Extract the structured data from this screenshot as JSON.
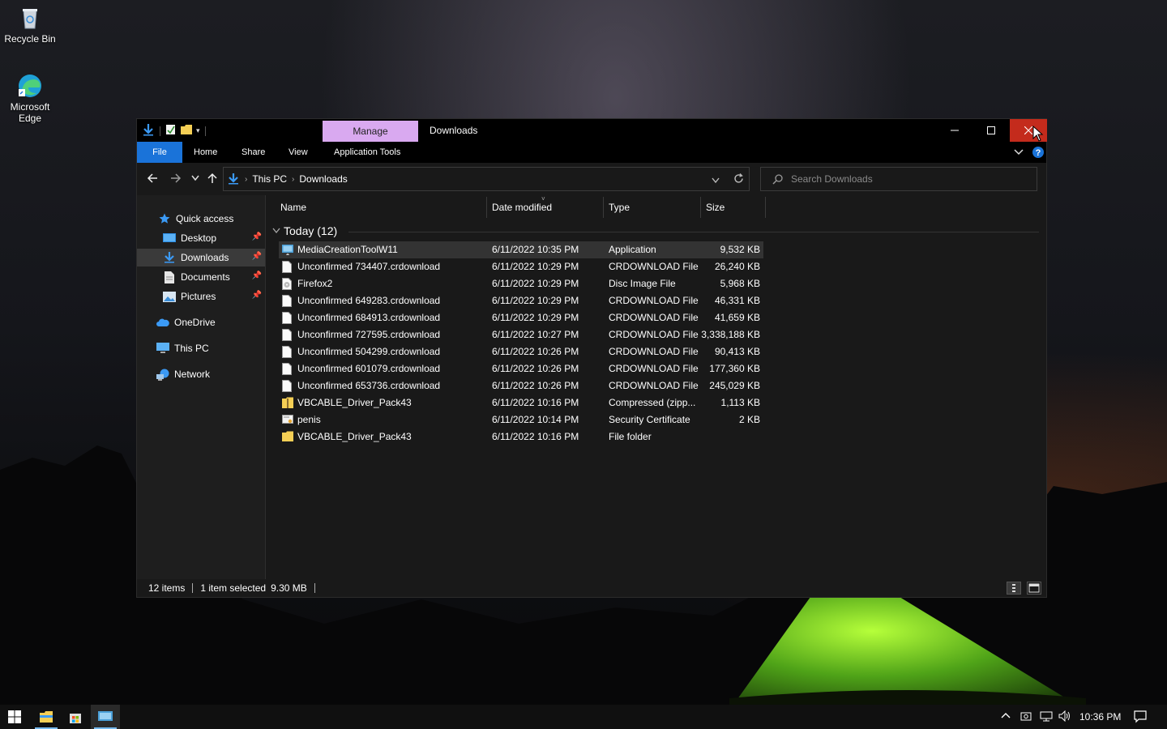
{
  "desktop": {
    "icons": [
      {
        "label": "Recycle Bin"
      },
      {
        "label": "Microsoft Edge"
      }
    ]
  },
  "window": {
    "title": "Downloads",
    "contextual_tab": "Manage",
    "ribbon_tabs": [
      "File",
      "Home",
      "Share",
      "View",
      "Application Tools"
    ]
  },
  "address": {
    "crumbs": [
      "This PC",
      "Downloads"
    ],
    "search_placeholder": "Search Downloads"
  },
  "nav": {
    "items": [
      {
        "label": "Quick access",
        "icon": "star-icon"
      },
      {
        "label": "Desktop",
        "icon": "desktop-folder-icon"
      },
      {
        "label": "Downloads",
        "icon": "download-arrow-icon"
      },
      {
        "label": "Documents",
        "icon": "document-icon"
      },
      {
        "label": "Pictures",
        "icon": "pictures-icon"
      },
      {
        "label": "OneDrive",
        "icon": "cloud-icon"
      },
      {
        "label": "This PC",
        "icon": "monitor-icon"
      },
      {
        "label": "Network",
        "icon": "network-icon"
      }
    ]
  },
  "columns": [
    "Name",
    "Date modified",
    "Type",
    "Size"
  ],
  "group_label": "Today (12)",
  "files": [
    {
      "name": "MediaCreationToolW11",
      "date": "6/11/2022 10:35 PM",
      "type": "Application",
      "size": "9,532 KB",
      "icon": "app-icon"
    },
    {
      "name": "Unconfirmed 734407.crdownload",
      "date": "6/11/2022 10:29 PM",
      "type": "CRDOWNLOAD File",
      "size": "26,240 KB",
      "icon": "file-icon"
    },
    {
      "name": "Firefox2",
      "date": "6/11/2022 10:29 PM",
      "type": "Disc Image File",
      "size": "5,968 KB",
      "icon": "disc-image-icon"
    },
    {
      "name": "Unconfirmed 649283.crdownload",
      "date": "6/11/2022 10:29 PM",
      "type": "CRDOWNLOAD File",
      "size": "46,331 KB",
      "icon": "file-icon"
    },
    {
      "name": "Unconfirmed 684913.crdownload",
      "date": "6/11/2022 10:29 PM",
      "type": "CRDOWNLOAD File",
      "size": "41,659 KB",
      "icon": "file-icon"
    },
    {
      "name": "Unconfirmed 727595.crdownload",
      "date": "6/11/2022 10:27 PM",
      "type": "CRDOWNLOAD File",
      "size": "3,338,188 KB",
      "icon": "file-icon"
    },
    {
      "name": "Unconfirmed 504299.crdownload",
      "date": "6/11/2022 10:26 PM",
      "type": "CRDOWNLOAD File",
      "size": "90,413 KB",
      "icon": "file-icon"
    },
    {
      "name": "Unconfirmed 601079.crdownload",
      "date": "6/11/2022 10:26 PM",
      "type": "CRDOWNLOAD File",
      "size": "177,360 KB",
      "icon": "file-icon"
    },
    {
      "name": "Unconfirmed 653736.crdownload",
      "date": "6/11/2022 10:26 PM",
      "type": "CRDOWNLOAD File",
      "size": "245,029 KB",
      "icon": "file-icon"
    },
    {
      "name": "VBCABLE_Driver_Pack43",
      "date": "6/11/2022 10:16 PM",
      "type": "Compressed (zipp...",
      "size": "1,113 KB",
      "icon": "zip-folder-icon"
    },
    {
      "name": "penis",
      "date": "6/11/2022 10:14 PM",
      "type": "Security Certificate",
      "size": "2 KB",
      "icon": "certificate-icon"
    },
    {
      "name": "VBCABLE_Driver_Pack43",
      "date": "6/11/2022 10:16 PM",
      "type": "File folder",
      "size": "",
      "icon": "folder-icon"
    }
  ],
  "status": {
    "count": "12 items",
    "selection": "1 item selected",
    "size": "9.30 MB"
  },
  "taskbar": {
    "time": "10:36 PM"
  },
  "colors": {
    "accent": "#1a73d9",
    "manage_tab": "#d9a9f0",
    "close_hover": "#c42b1c"
  }
}
